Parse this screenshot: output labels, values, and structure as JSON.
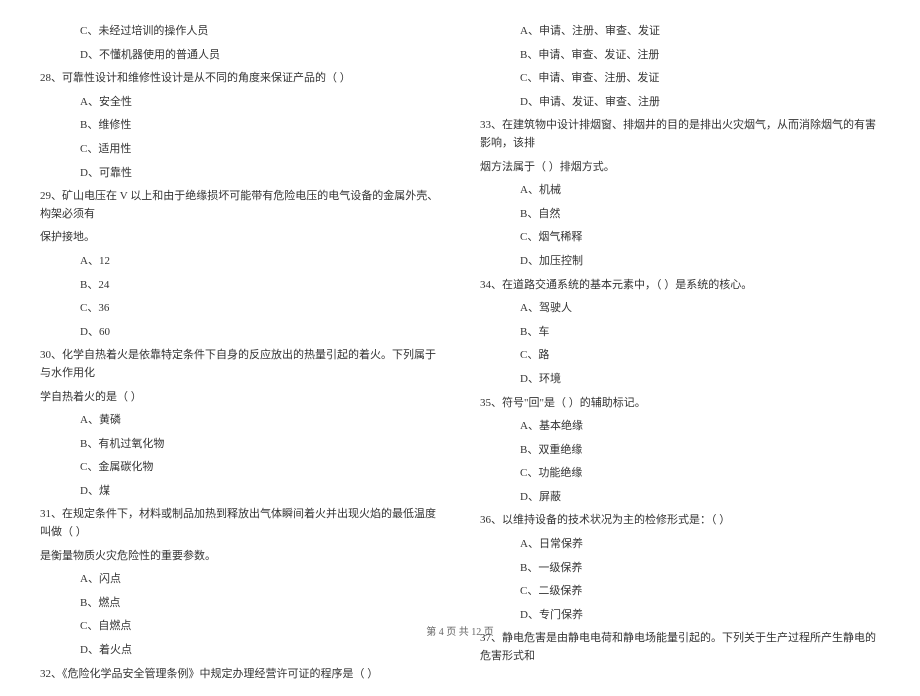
{
  "left": {
    "opt_c_27": "C、未经过培训的操作人员",
    "opt_d_27": "D、不懂机器使用的普通人员",
    "q28": "28、可靠性设计和维修性设计是从不同的角度来保证产品的（    ）",
    "opt_a_28": "A、安全性",
    "opt_b_28": "B、维修性",
    "opt_c_28": "C、适用性",
    "opt_d_28": "D、可靠性",
    "q29": "29、矿山电压在 V 以上和由于绝缘损坏可能带有危险电压的电气设备的金属外壳、构架必须有",
    "q29b": "保护接地。",
    "opt_a_29": "A、12",
    "opt_b_29": "B、24",
    "opt_c_29": "C、36",
    "opt_d_29": "D、60",
    "q30": "30、化学自热着火是依靠特定条件下自身的反应放出的热量引起的着火。下列属于与水作用化",
    "q30b": "学自热着火的是（    ）",
    "opt_a_30": "A、黄磷",
    "opt_b_30": "B、有机过氧化物",
    "opt_c_30": "C、金属碳化物",
    "opt_d_30": "D、煤",
    "q31": "31、在规定条件下，材料或制品加热到释放出气体瞬间着火并出现火焰的最低温度叫做（    ）",
    "q31b": "是衡量物质火灾危险性的重要参数。",
    "opt_a_31": "A、闪点",
    "opt_b_31": "B、燃点",
    "opt_c_31": "C、自燃点",
    "opt_d_31": "D、着火点",
    "q32": "32、《危险化学品安全管理条例》中规定办理经营许可证的程序是（    ）"
  },
  "right": {
    "opt_a_32": "A、申请、注册、审查、发证",
    "opt_b_32": "B、申请、审查、发证、注册",
    "opt_c_32": "C、申请、审查、注册、发证",
    "opt_d_32": "D、申请、发证、审查、注册",
    "q33": "33、在建筑物中设计排烟窗、排烟井的目的是排出火灾烟气，从而消除烟气的有害影响，该排",
    "q33b": "烟方法属于（    ）排烟方式。",
    "opt_a_33": "A、机械",
    "opt_b_33": "B、自然",
    "opt_c_33": "C、烟气稀释",
    "opt_d_33": "D、加压控制",
    "q34": "34、在道路交通系统的基本元素中，（    ）是系统的核心。",
    "opt_a_34": "A、驾驶人",
    "opt_b_34": "B、车",
    "opt_c_34": "C、路",
    "opt_d_34": "D、环境",
    "q35": "35、符号\"回\"是（    ）的辅助标记。",
    "opt_a_35": "A、基本绝缘",
    "opt_b_35": "B、双重绝缘",
    "opt_c_35": "C、功能绝缘",
    "opt_d_35": "D、屏蔽",
    "q36": "36、以维持设备的技术状况为主的检修形式是：（    ）",
    "opt_a_36": "A、日常保养",
    "opt_b_36": "B、一级保养",
    "opt_c_36": "C、二级保养",
    "opt_d_36": "D、专门保养",
    "q37": "37、静电危害是由静电电荷和静电场能量引起的。下列关于生产过程所产生静电的危害形式和"
  },
  "footer": "第 4 页 共 12 页"
}
